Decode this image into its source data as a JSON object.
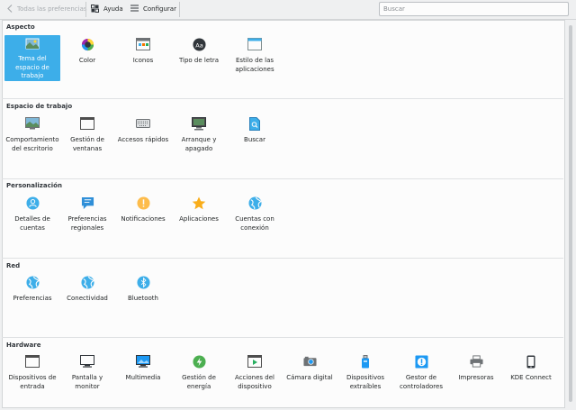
{
  "toolbar": {
    "back_label": "Todas las preferencias",
    "help_label": "Ayuda",
    "configure_label": "Configurar",
    "search_placeholder": "Buscar"
  },
  "colors": {
    "accent": "#3daee9",
    "background": "#eff0f1",
    "panel": "#fcfcfc"
  },
  "groups": [
    {
      "title": "Aspecto",
      "items": [
        {
          "label": "Tema del espacio de trabajo",
          "icon": "workspace-theme-icon",
          "selected": true
        },
        {
          "label": "Color",
          "icon": "color-wheel-icon"
        },
        {
          "label": "Iconos",
          "icon": "icons-icon"
        },
        {
          "label": "Tipo de letra",
          "icon": "font-icon"
        },
        {
          "label": "Estilo de las aplicaciones",
          "icon": "application-style-icon"
        }
      ]
    },
    {
      "title": "Espacio de trabajo",
      "items": [
        {
          "label": "Comportamiento del escritorio",
          "icon": "desktop-behavior-icon"
        },
        {
          "label": "Gestión de ventanas",
          "icon": "window-management-icon"
        },
        {
          "label": "Accesos rápidos",
          "icon": "keyboard-icon"
        },
        {
          "label": "Arranque y apagado",
          "icon": "startup-shutdown-icon"
        },
        {
          "label": "Buscar",
          "icon": "search-file-icon"
        }
      ]
    },
    {
      "title": "Personalización",
      "items": [
        {
          "label": "Detalles de cuentas",
          "icon": "user-account-icon"
        },
        {
          "label": "Preferencias regionales",
          "icon": "regional-flag-icon"
        },
        {
          "label": "Notificaciones",
          "icon": "notification-icon"
        },
        {
          "label": "Aplicaciones",
          "icon": "star-icon"
        },
        {
          "label": "Cuentas con conexión",
          "icon": "online-accounts-globe-icon"
        }
      ]
    },
    {
      "title": "Red",
      "items": [
        {
          "label": "Preferencias",
          "icon": "network-globe-icon"
        },
        {
          "label": "Conectividad",
          "icon": "connectivity-globe-icon"
        },
        {
          "label": "Bluetooth",
          "icon": "bluetooth-icon"
        }
      ]
    },
    {
      "title": "Hardware",
      "items": [
        {
          "label": "Dispositivos de entrada",
          "icon": "input-devices-icon"
        },
        {
          "label": "Pantalla y monitor",
          "icon": "monitor-icon"
        },
        {
          "label": "Multimedia",
          "icon": "multimedia-icon"
        },
        {
          "label": "Gestión de energía",
          "icon": "power-icon"
        },
        {
          "label": "Acciones del dispositivo",
          "icon": "device-actions-icon"
        },
        {
          "label": "Cámara digital",
          "icon": "camera-icon"
        },
        {
          "label": "Dispositivos extraíbles",
          "icon": "usb-drive-icon"
        },
        {
          "label": "Gestor de controladores",
          "icon": "driver-manager-icon"
        },
        {
          "label": "Impresoras",
          "icon": "printer-icon"
        },
        {
          "label": "KDE Connect",
          "icon": "phone-icon"
        }
      ]
    }
  ]
}
